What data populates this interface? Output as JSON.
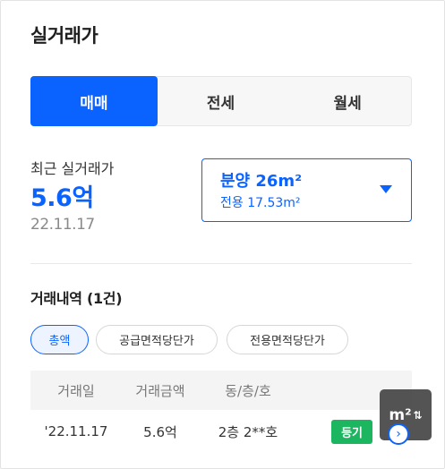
{
  "title": "실거래가",
  "tabs": [
    {
      "label": "매매",
      "active": true
    },
    {
      "label": "전세",
      "active": false
    },
    {
      "label": "월세",
      "active": false
    }
  ],
  "recent": {
    "label": "최근 실거래가",
    "price": "5.6억",
    "date": "22.11.17"
  },
  "area_select": {
    "main": "분양 26m²",
    "sub": "전용 17.53m²",
    "icon": "caret-down-icon"
  },
  "history": {
    "title": "거래내역 (1건)",
    "filters": [
      {
        "label": "총액",
        "active": true
      },
      {
        "label": "공급면적당단가",
        "active": false
      },
      {
        "label": "전용면적당단가",
        "active": false
      }
    ],
    "columns": [
      "거래일",
      "거래금액",
      "동/층/호"
    ],
    "rows": [
      {
        "date": "'22.11.17",
        "amount": "5.6억",
        "unit": "2층 2**호",
        "badge": "등기"
      }
    ]
  },
  "unit_toggle": {
    "label": "m²",
    "icon": "swap-arrows-icon",
    "arrows": "⇅"
  },
  "next_icon": "chevron-right-icon",
  "colors": {
    "accent": "#0b63ff",
    "badge": "#1db660",
    "toggle_bg": "#4b4b4b"
  }
}
